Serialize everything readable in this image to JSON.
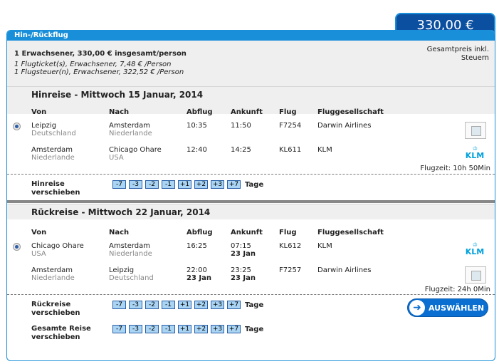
{
  "header": {
    "title": "Hin-/Rückflug",
    "price": "330,00 €",
    "total_label": "Gesamtpreis inkl. Steuern"
  },
  "summary": {
    "line1": "1 Erwachsener, 330,00 € insgesamt/person",
    "line2": "1 Flugticket(s), Erwachsener, 7,48 € /Person",
    "line3": "1 Flugsteuer(n), Erwachsener, 322,52 € /Person"
  },
  "columns": {
    "from": "Von",
    "to": "Nach",
    "dep": "Abflug",
    "arr": "Ankunft",
    "flight": "Flug",
    "airline": "Fluggesellschaft"
  },
  "outbound": {
    "title": "Hinreise - Mittwoch 15 Januar, 2014",
    "legs": [
      {
        "from_city": "Leipzig",
        "from_country": "Deutschland",
        "to_city": "Amsterdam",
        "to_country": "Niederlande",
        "dep": "10:35",
        "arr": "11:50",
        "flight": "F7254",
        "airline": "Darwin Airlines",
        "logo": "image-placeholder"
      },
      {
        "from_city": "Amsterdam",
        "from_country": "Niederlande",
        "to_city": "Chicago Ohare",
        "to_country": "USA",
        "dep": "12:40",
        "arr": "14:25",
        "flight": "KL611",
        "airline": "KLM",
        "logo": "klm-logo"
      }
    ],
    "duration": "Flugzeit: 10h 50Min",
    "shift_label": "Hinreise verschieben"
  },
  "inbound": {
    "title": "Rückreise - Mittwoch 22 Januar, 2014",
    "legs": [
      {
        "from_city": "Chicago Ohare",
        "from_country": "USA",
        "to_city": "Amsterdam",
        "to_country": "Niederlande",
        "dep": "16:25",
        "dep_date": "",
        "arr": "07:15",
        "arr_date": "23 Jan",
        "flight": "KL612",
        "airline": "KLM",
        "logo": "klm-logo"
      },
      {
        "from_city": "Amsterdam",
        "from_country": "Niederlande",
        "to_city": "Leipzig",
        "to_country": "Deutschland",
        "dep": "22:00",
        "dep_date": "23 Jan",
        "arr": "23:25",
        "arr_date": "23 Jan",
        "flight": "F7257",
        "airline": "Darwin Airlines",
        "logo": "image-placeholder"
      }
    ],
    "duration": "Flugzeit: 24h 0Min",
    "shift_label": "Rückreise verschieben"
  },
  "total_shift_label": "Gesamte Reise verschieben",
  "shift_buttons": [
    "-7",
    "-3",
    "-2",
    "-1",
    "+1",
    "+2",
    "+3",
    "+7"
  ],
  "shift_unit": "Tage",
  "klm_text": "KLM",
  "select_button": "AUSWÄHLEN",
  "colors": {
    "accent": "#1a8fd9",
    "price_bg": "#0b4fa0",
    "klm": "#00a1de"
  }
}
